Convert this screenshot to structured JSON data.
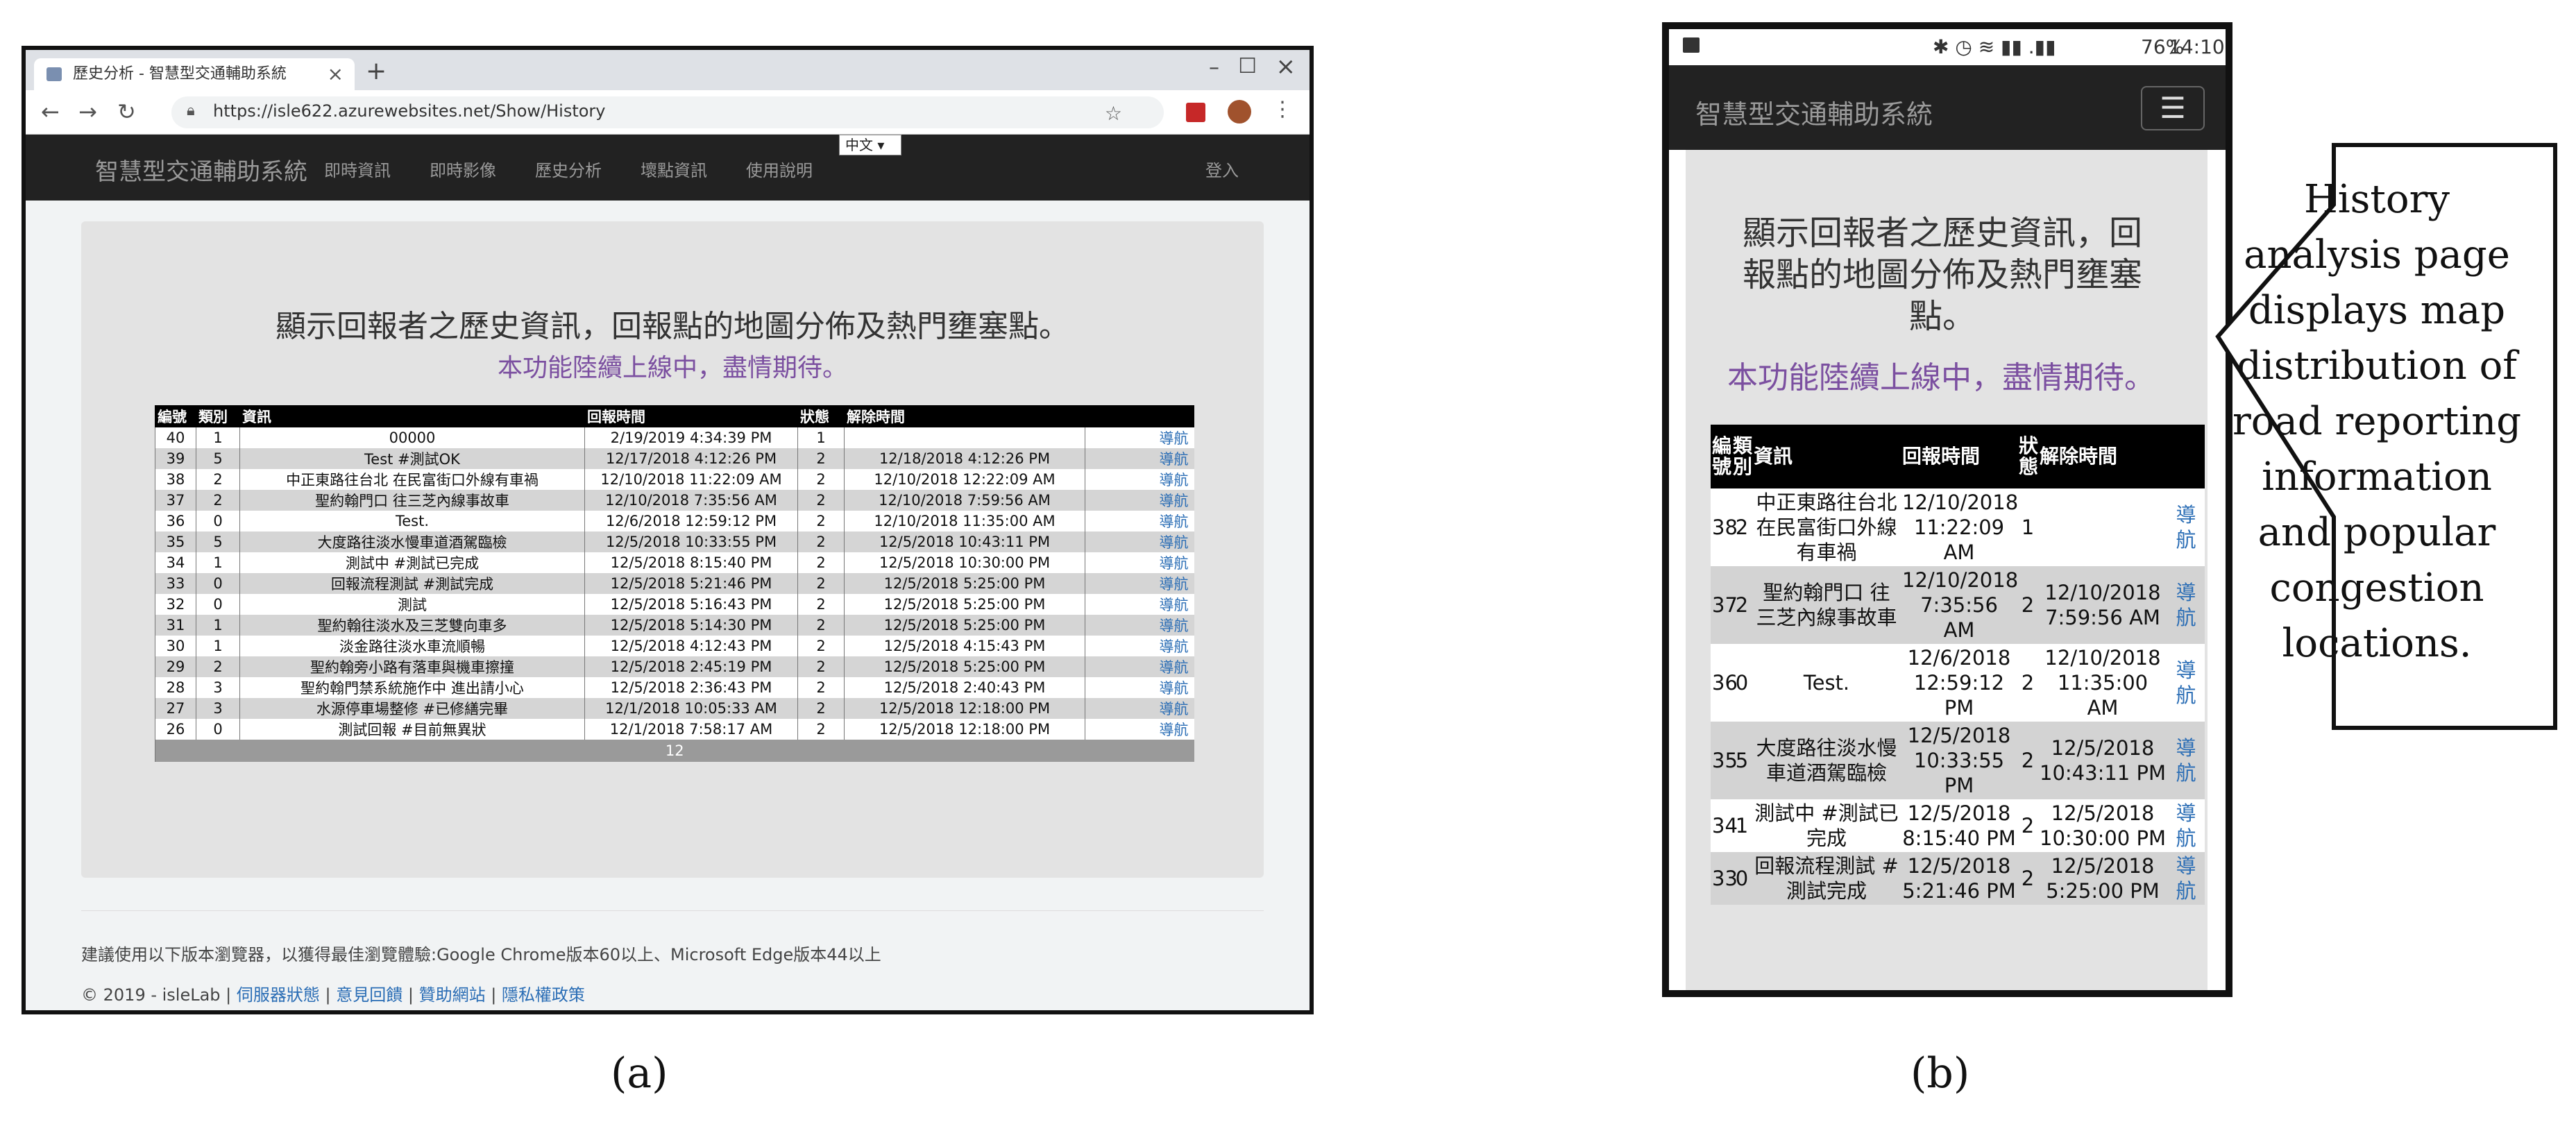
{
  "panel_a": {
    "browser": {
      "tab_title": "歷史分析 - 智慧型交通輔助系統",
      "tab_close": "×",
      "new_tab": "+",
      "url": "https://isle622.azurewebsites.net/Show/History"
    },
    "site_nav": {
      "brand": "智慧型交通輔助系統",
      "items": [
        "即時資訊",
        "即時影像",
        "歷史分析",
        "壞點資訊",
        "使用說明"
      ],
      "lang": "中文 ▾",
      "login": "登入"
    },
    "heading": "顯示回報者之歷史資訊，回報點的地圖分佈及熱門壅塞點。",
    "subheading": "本功能陸續上線中，盡情期待。",
    "table": {
      "headers": [
        "編號",
        "類別",
        "資訊",
        "回報時間",
        "狀態",
        "解除時間",
        ""
      ],
      "rows": [
        [
          "40",
          "1",
          "00000",
          "2/19/2019 4:34:39 PM",
          "1",
          "",
          "導航"
        ],
        [
          "39",
          "5",
          "Test #測試OK",
          "12/17/2018 4:12:26 PM",
          "2",
          "12/18/2018 4:12:26 PM",
          "導航"
        ],
        [
          "38",
          "2",
          "中正東路往台北 在民富街口外線有車禍",
          "12/10/2018 11:22:09 AM",
          "2",
          "12/10/2018 12:22:09 AM",
          "導航"
        ],
        [
          "37",
          "2",
          "聖約翰門口 往三芝內線事故車",
          "12/10/2018 7:35:56 AM",
          "2",
          "12/10/2018 7:59:56 AM",
          "導航"
        ],
        [
          "36",
          "0",
          "Test.",
          "12/6/2018 12:59:12 PM",
          "2",
          "12/10/2018 11:35:00 AM",
          "導航"
        ],
        [
          "35",
          "5",
          "大度路往淡水慢車道酒駕臨檢",
          "12/5/2018 10:33:55 PM",
          "2",
          "12/5/2018 10:43:11 PM",
          "導航"
        ],
        [
          "34",
          "1",
          "測試中 #測試已完成",
          "12/5/2018 8:15:40 PM",
          "2",
          "12/5/2018 10:30:00 PM",
          "導航"
        ],
        [
          "33",
          "0",
          "回報流程測試 #測試完成",
          "12/5/2018 5:21:46 PM",
          "2",
          "12/5/2018 5:25:00 PM",
          "導航"
        ],
        [
          "32",
          "0",
          "測試",
          "12/5/2018 5:16:43 PM",
          "2",
          "12/5/2018 5:25:00 PM",
          "導航"
        ],
        [
          "31",
          "1",
          "聖約翰往淡水及三芝雙向車多",
          "12/5/2018 5:14:30 PM",
          "2",
          "12/5/2018 5:25:00 PM",
          "導航"
        ],
        [
          "30",
          "1",
          "淡金路往淡水車流順暢",
          "12/5/2018 4:12:43 PM",
          "2",
          "12/5/2018 4:15:43 PM",
          "導航"
        ],
        [
          "29",
          "2",
          "聖約翰旁小路有落車與機車擦撞",
          "12/5/2018 2:45:19 PM",
          "2",
          "12/5/2018 5:25:00 PM",
          "導航"
        ],
        [
          "28",
          "3",
          "聖約翰門禁系統施作中 進出請小心",
          "12/5/2018 2:36:43 PM",
          "2",
          "12/5/2018 2:40:43 PM",
          "導航"
        ],
        [
          "27",
          "3",
          "水源停車場整修 #已修繕完畢",
          "12/1/2018 10:05:33 AM",
          "2",
          "12/5/2018 12:18:00 PM",
          "導航"
        ],
        [
          "26",
          "0",
          "測試回報 #目前無異狀",
          "12/1/2018 7:58:17 AM",
          "2",
          "12/5/2018 12:18:00 PM",
          "導航"
        ]
      ],
      "pager": "12"
    },
    "footer": {
      "browser_note": "建議使用以下版本瀏覽器，以獲得最佳瀏覽體驗:Google Chrome版本60以上、Microsoft Edge版本44以上",
      "copyright": "© 2019 - isleLab",
      "links": [
        "伺服器狀態",
        "意見回饋",
        "贊助網站",
        "隱私權政策"
      ]
    },
    "label": "(a)"
  },
  "panel_b": {
    "status_bar": {
      "icons_text": "✱ ◷ ≋ ▮▮ .▮▮",
      "battery": "76%",
      "time": "14:10"
    },
    "nav": {
      "brand": "智慧型交通輔助系統",
      "menu_icon": "☰"
    },
    "heading": "顯示回報者之歷史資訊，回報點的地圖分佈及熱門壅塞點。",
    "subheading": "本功能陸續上線中，盡情期待。",
    "table": {
      "headers": [
        "編號",
        "類別",
        "資訊",
        "回報時間",
        "狀態",
        "解除時間",
        ""
      ],
      "rows": [
        [
          "38",
          "2",
          "中正東路往台北 在民富街口外線有車禍",
          "12/10/2018 11:22:09 AM",
          "1",
          "",
          "導航"
        ],
        [
          "37",
          "2",
          "聖約翰門口 往三芝內線事故車",
          "12/10/2018 7:35:56 AM",
          "2",
          "12/10/2018 7:59:56 AM",
          "導航"
        ],
        [
          "36",
          "0",
          "Test.",
          "12/6/2018 12:59:12 PM",
          "2",
          "12/10/2018 11:35:00 AM",
          "導航"
        ],
        [
          "35",
          "5",
          "大度路往淡水慢車道酒駕臨檢",
          "12/5/2018 10:33:55 PM",
          "2",
          "12/5/2018 10:43:11 PM",
          "導航"
        ],
        [
          "34",
          "1",
          "測試中 #測試已完成",
          "12/5/2018 8:15:40 PM",
          "2",
          "12/5/2018 10:30:00 PM",
          "導航"
        ],
        [
          "33",
          "0",
          "回報流程測試 #測試完成",
          "12/5/2018 5:21:46 PM",
          "2",
          "12/5/2018 5:25:00 PM",
          "導航"
        ]
      ]
    },
    "label": "(b)"
  },
  "callout": {
    "text": "History analysis page displays map distribution of road reporting information and popular congestion locations."
  }
}
